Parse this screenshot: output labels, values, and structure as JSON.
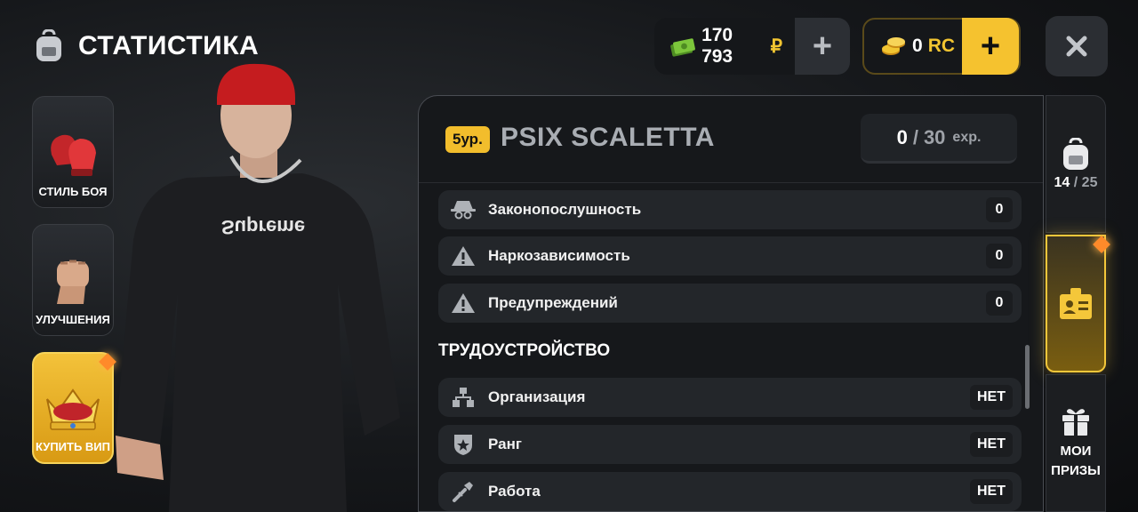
{
  "header": {
    "title": "СТАТИСТИКА",
    "icon": "backpack-icon"
  },
  "currency": {
    "money": "170 793",
    "money_symbol": "₽",
    "rc_value": "0",
    "rc_label": "RC",
    "money_plus": "+",
    "rc_plus": "+"
  },
  "close_label": "✕",
  "left_menu": [
    {
      "label": "СТИЛЬ БОЯ",
      "icon": "boxing-gloves-icon"
    },
    {
      "label": "УЛУЧШЕНИЯ",
      "icon": "fist-icon"
    },
    {
      "label": "КУПИТЬ ВИП",
      "icon": "crown-icon"
    }
  ],
  "character": {
    "shirt_text": "Supreme"
  },
  "player": {
    "level": "5ур.",
    "name": "PSIX SCALETTA",
    "exp_current": "0",
    "exp_sep": "/",
    "exp_max": "30",
    "exp_unit": "exp."
  },
  "stats": [
    {
      "label": "Законопослушность",
      "value": "0",
      "icon": "spy-hat-icon"
    },
    {
      "label": "Наркозависимость",
      "value": "0",
      "icon": "warning-icon"
    },
    {
      "label": "Предупреждений",
      "value": "0",
      "icon": "warning-icon"
    }
  ],
  "employment": {
    "title": "ТРУДОУСТРОЙСТВО",
    "rows": [
      {
        "label": "Организация",
        "value": "НЕТ",
        "icon": "org-chart-icon"
      },
      {
        "label": "Ранг",
        "value": "НЕТ",
        "icon": "rank-badge-icon"
      },
      {
        "label": "Работа",
        "value": "НЕТ",
        "icon": "wrench-icon"
      }
    ]
  },
  "right_menu": {
    "inventory_current": "14",
    "inventory_sep": "/",
    "inventory_max": "25",
    "prizes_line1": "МОИ",
    "prizes_line2": "ПРИЗЫ"
  },
  "colors": {
    "accent": "#f2bd2c",
    "cash_green": "#7cc63b"
  }
}
